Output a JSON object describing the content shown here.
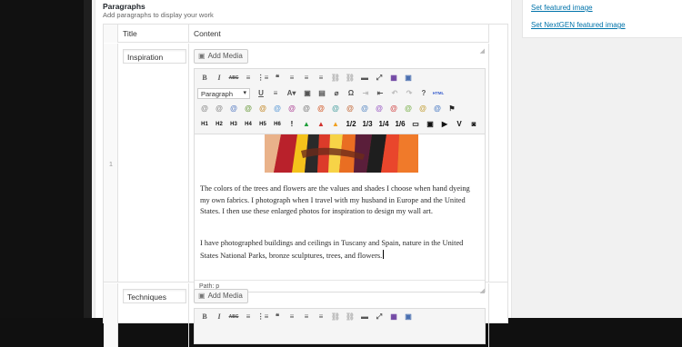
{
  "postbox": {
    "title": "Paragraphs",
    "subtitle": "Add paragraphs to display your work"
  },
  "repeater": {
    "columns": {
      "title": "Title",
      "content": "Content"
    },
    "rows": [
      {
        "order": "1",
        "title": "Inspiration",
        "add_media_label": "Add Media",
        "format_select": "Paragraph",
        "paragraph1": "The colors of the trees and flowers are the values and shades I choose when hand dyeing my own fabrics.  I photograph when I travel with my husband in Europe and the United States. I then use these enlarged photos for inspiration to design my wall art.",
        "paragraph2": "I have photographed buildings and ceilings in Tuscany and Spain, nature in the United States National Parks, bronze sculptures, trees, and flowers.",
        "path": "Path: p"
      },
      {
        "order": "",
        "title": "Techniques",
        "add_media_label": "Add Media"
      }
    ]
  },
  "toolbar": {
    "row1": [
      "B",
      "I",
      "ABC",
      "≡",
      "⋮≡",
      "❝",
      "≡",
      "≡",
      "≡",
      "⛓",
      "⛓",
      "▬",
      "⤢",
      "▦",
      "▣"
    ],
    "row2_after_select": [
      "U",
      "≡",
      "A▾",
      "▣",
      "▤",
      "⌀",
      "Ω",
      "⇥",
      "⇤",
      "↶",
      "↷",
      "?",
      "HTML"
    ],
    "row3": [
      "@",
      "@",
      "@",
      "@",
      "@",
      "@",
      "@",
      "@",
      "@",
      "@",
      "@",
      "@",
      "@",
      "@",
      "@",
      "@",
      "@",
      "⚑"
    ],
    "row4": [
      "H1",
      "H2",
      "H3",
      "H4",
      "H5",
      "H6",
      "!",
      "▲",
      "▲",
      "▲",
      "1/2",
      "1/3",
      "1/4",
      "1/6",
      "▭",
      "▣",
      "▶",
      "V",
      "◙"
    ]
  },
  "sidebar": {
    "featured_link": "Set featured image",
    "nextgen_link": "Set NextGEN featured image"
  },
  "colors": {
    "link": "#0073aa",
    "warn_green": "#1e9e3a",
    "warn_red": "#d0312d",
    "warn_orange": "#f0a020"
  }
}
